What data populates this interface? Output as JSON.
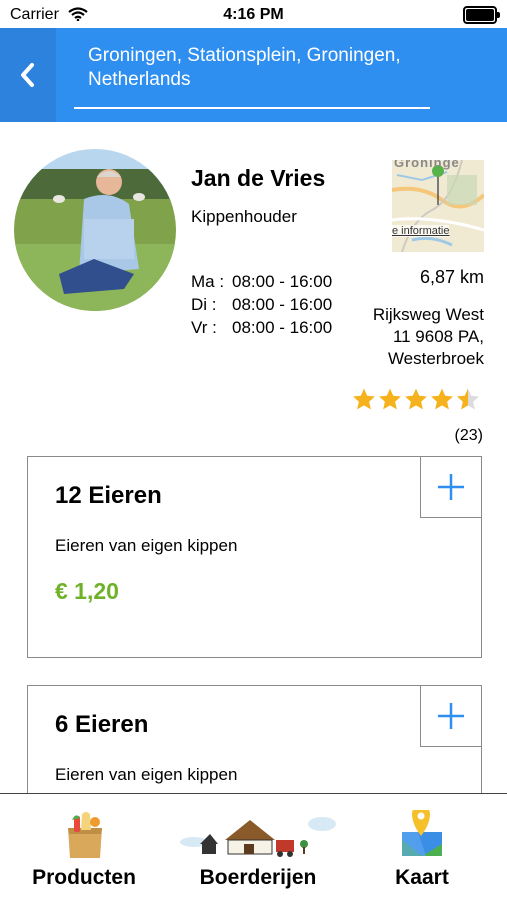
{
  "status_bar": {
    "carrier": "Carrier",
    "time": "4:16 PM"
  },
  "header": {
    "location": "Groningen, Stationsplein, Groningen, Netherlands"
  },
  "farmer": {
    "name": "Jan de Vries",
    "role": "Kippenhouder",
    "hours": [
      {
        "day": "Ma :",
        "time": "08:00 - 16:00"
      },
      {
        "day": "Di :",
        "time": "08:00 - 16:00"
      },
      {
        "day": "Vr :",
        "time": "08:00 - 16:00"
      }
    ],
    "distance": "6,87 km",
    "address_line1": "Rijksweg West",
    "address_line2": "11 9608 PA,",
    "address_line3": "Westerbroek",
    "rating": 4.5,
    "reviews": "(23)",
    "map_place_label": "Groninge",
    "map_info_label": "e informatie"
  },
  "products": [
    {
      "title": "12 Eieren",
      "description": "Eieren van eigen kippen",
      "price": "€ 1,20"
    },
    {
      "title": "6 Eieren",
      "description": "Eieren van eigen kippen"
    }
  ],
  "tabs": {
    "products": "Producten",
    "farms": "Boerderijen",
    "map": "Kaart"
  },
  "colors": {
    "header": "#2e8ff0",
    "price": "#6fb22a",
    "star": "#f5b21c",
    "add_icon": "#2e8ff0"
  }
}
